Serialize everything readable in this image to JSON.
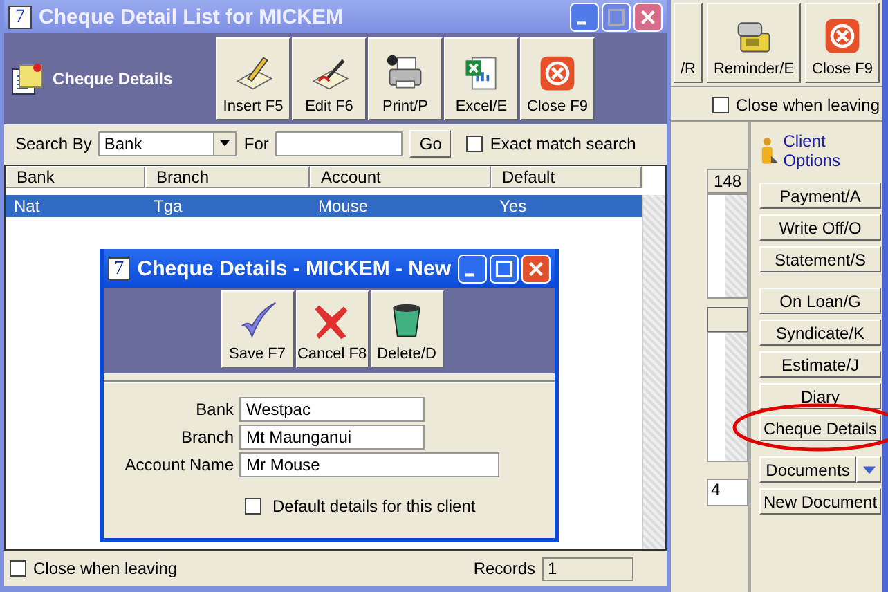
{
  "back_window": {
    "toolbar": [
      {
        "label": "/R",
        "kind": "partial"
      },
      {
        "label": "Reminder/E",
        "kind": "reminder"
      },
      {
        "label": "Close F9",
        "kind": "close"
      }
    ],
    "close_when_leaving": {
      "label": "Close when leaving",
      "checked": false
    },
    "count": "148",
    "field_value": "4",
    "client_options": {
      "title": "Client Options",
      "groups": [
        [
          {
            "label": "Payment/A",
            "kind": "plain",
            "highlighted": false
          },
          {
            "label": "Write Off/O",
            "kind": "plain",
            "highlighted": false
          },
          {
            "label": "Statement/S",
            "kind": "plain",
            "highlighted": false
          }
        ],
        [
          {
            "label": "On Loan/G",
            "kind": "plain",
            "highlighted": false
          },
          {
            "label": "Syndicate/K",
            "kind": "plain",
            "highlighted": false
          },
          {
            "label": "Estimate/J",
            "kind": "plain",
            "highlighted": false
          },
          {
            "label": "Diary",
            "kind": "plain",
            "highlighted": false
          },
          {
            "label": "Cheque Details",
            "kind": "plain",
            "highlighted": true
          }
        ],
        [
          {
            "label": "Documents",
            "kind": "split",
            "highlighted": false
          },
          {
            "label": "New Document",
            "kind": "plain",
            "highlighted": false
          }
        ]
      ]
    }
  },
  "window": {
    "app_icon": "7",
    "title": "Cheque Detail List for MICKEM"
  },
  "header": {
    "title": "Cheque Details"
  },
  "toolbar": [
    {
      "label": "Insert F5",
      "kind": "insert"
    },
    {
      "label": "Edit F6",
      "kind": "edit"
    },
    {
      "label": "Print/P",
      "kind": "print"
    },
    {
      "label": "Excel/E",
      "kind": "excel"
    },
    {
      "label": "Close F9",
      "kind": "close"
    }
  ],
  "search": {
    "label": "Search By",
    "value": "Bank",
    "for_label": "For",
    "go": "Go",
    "exact_match": {
      "label": "Exact match search",
      "checked": false
    }
  },
  "table": {
    "columns": [
      "Bank",
      "Branch",
      "Account",
      "Default"
    ],
    "rows": [
      {
        "cells": [
          "Nat",
          "Tga",
          "Mouse",
          "Yes"
        ],
        "selected": true
      }
    ]
  },
  "footer": {
    "close_when_leaving": {
      "label": "Close when leaving",
      "checked": false
    },
    "records_label": "Records",
    "records": "1"
  },
  "dialog": {
    "app_icon": "7",
    "title": "Cheque Details - MICKEM - New",
    "toolbar": [
      {
        "label": "Save F7",
        "kind": "save"
      },
      {
        "label": "Cancel F8",
        "kind": "cancel"
      },
      {
        "label": "Delete/D",
        "kind": "delete"
      }
    ],
    "fields": [
      {
        "label": "Bank",
        "value": "Westpac",
        "kind": "short"
      },
      {
        "label": "Branch",
        "value": "Mt Maunganui",
        "kind": "short"
      },
      {
        "label": "Account Name",
        "value": "Mr Mouse",
        "kind": "long"
      }
    ],
    "default_check": {
      "label": "Default details for this client",
      "checked": false
    }
  }
}
